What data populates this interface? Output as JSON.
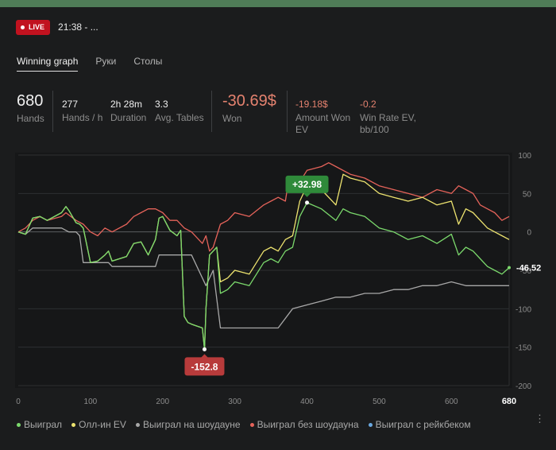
{
  "header": {
    "live_label": "LIVE",
    "session_label": "21:38 - ..."
  },
  "tabs": [
    {
      "label": "Winning graph",
      "active": true
    },
    {
      "label": "Руки",
      "active": false
    },
    {
      "label": "Столы",
      "active": false
    }
  ],
  "stats": {
    "hands": {
      "value": "680",
      "label": "Hands"
    },
    "hands_per_h": {
      "value": "277",
      "label": "Hands / h"
    },
    "duration": {
      "value": "2h 28m",
      "label": "Duration"
    },
    "avg_tables": {
      "value": "3.3",
      "label": "Avg. Tables"
    },
    "won": {
      "value": "-30.69$",
      "label": "Won"
    },
    "amount_won_ev": {
      "value": "-19.18$",
      "label_line1": "Amount Won",
      "label_line2": "EV"
    },
    "win_rate_ev": {
      "value": "-0.2",
      "label_line1": "Win Rate EV,",
      "label_line2": "bb/100"
    }
  },
  "colors": {
    "green": "#7bd96c",
    "yellow": "#ede36f",
    "gray": "#a8a8a8",
    "red": "#e5635a",
    "blue": "#6aa8e0",
    "live": "#c1121f"
  },
  "chart_data": {
    "type": "line",
    "x_ticks": [
      "0",
      "100",
      "200",
      "300",
      "400",
      "500",
      "600",
      "680"
    ],
    "y_ticks": [
      "100",
      "50",
      "0",
      "-50",
      "-100",
      "-150",
      "-200"
    ],
    "xlim": [
      0,
      680
    ],
    "ylim": [
      -200,
      100
    ],
    "grid": true,
    "legend_position": "bottom",
    "annotations": {
      "max_label": "+32.98",
      "min_label": "-152.8",
      "end_label": "-46.52"
    },
    "series": [
      {
        "name": "Выиграл",
        "color": "#7bd96c",
        "x": [
          0,
          10,
          20,
          30,
          40,
          60,
          66,
          70,
          80,
          85,
          90,
          100,
          110,
          120,
          125,
          130,
          150,
          160,
          170,
          180,
          190,
          195,
          200,
          210,
          220,
          225,
          230,
          235,
          240,
          255,
          258,
          260,
          265,
          270,
          275,
          280,
          290,
          300,
          320,
          340,
          350,
          360,
          370,
          380,
          390,
          400,
          420,
          440,
          450,
          460,
          480,
          500,
          520,
          540,
          560,
          580,
          600,
          610,
          620,
          630,
          640,
          650,
          660,
          670,
          680
        ],
        "y": [
          0,
          -3,
          18,
          20,
          15,
          25,
          33,
          28,
          12,
          10,
          5,
          -40,
          -38,
          -30,
          -25,
          -38,
          -32,
          -15,
          -13,
          -30,
          -10,
          18,
          20,
          2,
          -5,
          2,
          -110,
          -118,
          -120,
          -125,
          -152.8,
          -100,
          -30,
          -25,
          -20,
          -80,
          -75,
          -65,
          -70,
          -40,
          -35,
          -40,
          -25,
          -20,
          20,
          38,
          30,
          15,
          30,
          25,
          20,
          5,
          0,
          -10,
          -5,
          -15,
          -3,
          -30,
          -20,
          -25,
          -35,
          -45,
          -50,
          -55,
          -46.52
        ]
      },
      {
        "name": "Олл-ин EV",
        "color": "#ede36f",
        "x": [
          0,
          10,
          20,
          30,
          40,
          60,
          66,
          70,
          80,
          85,
          90,
          100,
          110,
          120,
          125,
          130,
          150,
          160,
          170,
          180,
          190,
          195,
          200,
          210,
          220,
          225,
          230,
          235,
          240,
          255,
          258,
          260,
          265,
          270,
          275,
          280,
          290,
          300,
          320,
          340,
          350,
          360,
          370,
          380,
          390,
          400,
          420,
          440,
          450,
          460,
          480,
          500,
          520,
          540,
          560,
          580,
          600,
          610,
          620,
          630,
          640,
          650,
          660,
          670,
          680
        ],
        "y": [
          0,
          -3,
          18,
          20,
          15,
          25,
          33,
          28,
          12,
          10,
          5,
          -40,
          -38,
          -30,
          -25,
          -38,
          -32,
          -15,
          -13,
          -30,
          -10,
          18,
          20,
          2,
          -5,
          2,
          -110,
          -118,
          -120,
          -125,
          -152.8,
          -100,
          -30,
          -25,
          -20,
          -65,
          -60,
          -50,
          -55,
          -25,
          -20,
          -25,
          -10,
          -5,
          40,
          60,
          55,
          35,
          75,
          70,
          65,
          50,
          45,
          40,
          45,
          35,
          40,
          10,
          30,
          25,
          15,
          5,
          0,
          -5,
          -10
        ]
      },
      {
        "name": "Выиграл на шоудауне",
        "color": "#a8a8a8",
        "x": [
          0,
          10,
          20,
          40,
          60,
          70,
          80,
          85,
          90,
          100,
          120,
          125,
          130,
          150,
          160,
          170,
          180,
          190,
          195,
          200,
          220,
          240,
          255,
          260,
          270,
          280,
          290,
          300,
          330,
          340,
          360,
          380,
          400,
          420,
          440,
          460,
          480,
          500,
          520,
          540,
          560,
          580,
          600,
          620,
          640,
          660,
          680
        ],
        "y": [
          0,
          -3,
          5,
          5,
          5,
          0,
          0,
          -5,
          -40,
          -40,
          -40,
          -40,
          -45,
          -45,
          -45,
          -45,
          -45,
          -45,
          -30,
          -30,
          -30,
          -30,
          -60,
          -70,
          -50,
          -125,
          -125,
          -125,
          -125,
          -125,
          -125,
          -100,
          -95,
          -90,
          -85,
          -85,
          -80,
          -80,
          -75,
          -75,
          -70,
          -70,
          -65,
          -70,
          -70,
          -70,
          -70
        ]
      },
      {
        "name": "Выиграл без шоудауна",
        "color": "#e5635a",
        "x": [
          0,
          10,
          20,
          30,
          40,
          60,
          66,
          70,
          80,
          90,
          100,
          110,
          120,
          130,
          150,
          160,
          170,
          180,
          190,
          200,
          210,
          220,
          230,
          240,
          250,
          255,
          260,
          265,
          270,
          280,
          290,
          300,
          320,
          340,
          350,
          360,
          370,
          375,
          380,
          390,
          400,
          420,
          430,
          440,
          460,
          480,
          500,
          520,
          540,
          560,
          580,
          600,
          610,
          620,
          630,
          640,
          650,
          660,
          670,
          680
        ],
        "y": [
          0,
          5,
          15,
          20,
          15,
          20,
          25,
          22,
          15,
          10,
          0,
          -5,
          5,
          0,
          10,
          20,
          25,
          30,
          30,
          25,
          15,
          15,
          5,
          0,
          -10,
          -15,
          -5,
          -25,
          -20,
          10,
          15,
          25,
          20,
          35,
          40,
          45,
          40,
          70,
          70,
          65,
          80,
          85,
          90,
          85,
          75,
          70,
          60,
          55,
          50,
          45,
          55,
          50,
          60,
          55,
          50,
          35,
          30,
          25,
          15,
          20
        ]
      }
    ]
  },
  "legend": [
    {
      "label": "Выиграл",
      "color": "#7bd96c"
    },
    {
      "label": "Олл-ин EV",
      "color": "#ede36f"
    },
    {
      "label": "Выиграл на шоудауне",
      "color": "#a8a8a8"
    },
    {
      "label": "Выиграл без шоудауна",
      "color": "#e5635a"
    },
    {
      "label": "Выиграл с рейкбеком",
      "color": "#6aa8e0"
    }
  ],
  "more_icon": "kebab-icon"
}
